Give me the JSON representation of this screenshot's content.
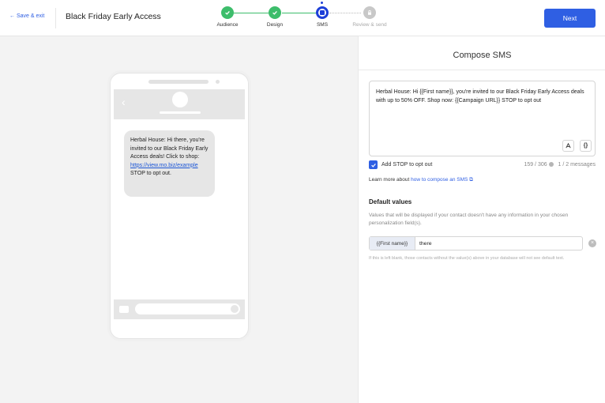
{
  "header": {
    "save_exit": "← Save & exit",
    "campaign_title": "Black Friday Early Access",
    "next_label": "Next"
  },
  "stepper": {
    "steps": [
      {
        "label": "Audience",
        "state": "done"
      },
      {
        "label": "Design",
        "state": "done"
      },
      {
        "label": "SMS",
        "state": "current"
      },
      {
        "label": "Review & send",
        "state": "locked"
      }
    ]
  },
  "preview": {
    "message_part1": "Herbal House: Hi there, you're invited to our Black Friday Early Access deals! Click to shop: ",
    "link": "https://view.mo.biz/example",
    "message_part2": " STOP to opt out."
  },
  "compose": {
    "title": "Compose SMS",
    "sms_text": "Herbal House: Hi {{First name}}, you're invited to our Black Friday Early Access deals with up to 50% OFF. Shop now: {{Campaign URL}} STOP to opt out",
    "stop_label": "Add STOP to opt out",
    "char_count": "159 / 306",
    "message_count": "1 / 2 messages",
    "learn_prefix": "Learn more about ",
    "learn_link": "how to compose an SMS",
    "default_values_title": "Default values",
    "default_values_desc": "Values that will be displayed if your contact doesn't have any information in your chosen personalization field(s).",
    "field_tag": "{{First name}}",
    "field_value": "there",
    "note": "If this is left blank, those contacts without the value(s) above in your database will not see default text."
  },
  "colors": {
    "accent": "#2f5fe3",
    "done": "#3dbd6b",
    "current": "#1d3fd8"
  }
}
